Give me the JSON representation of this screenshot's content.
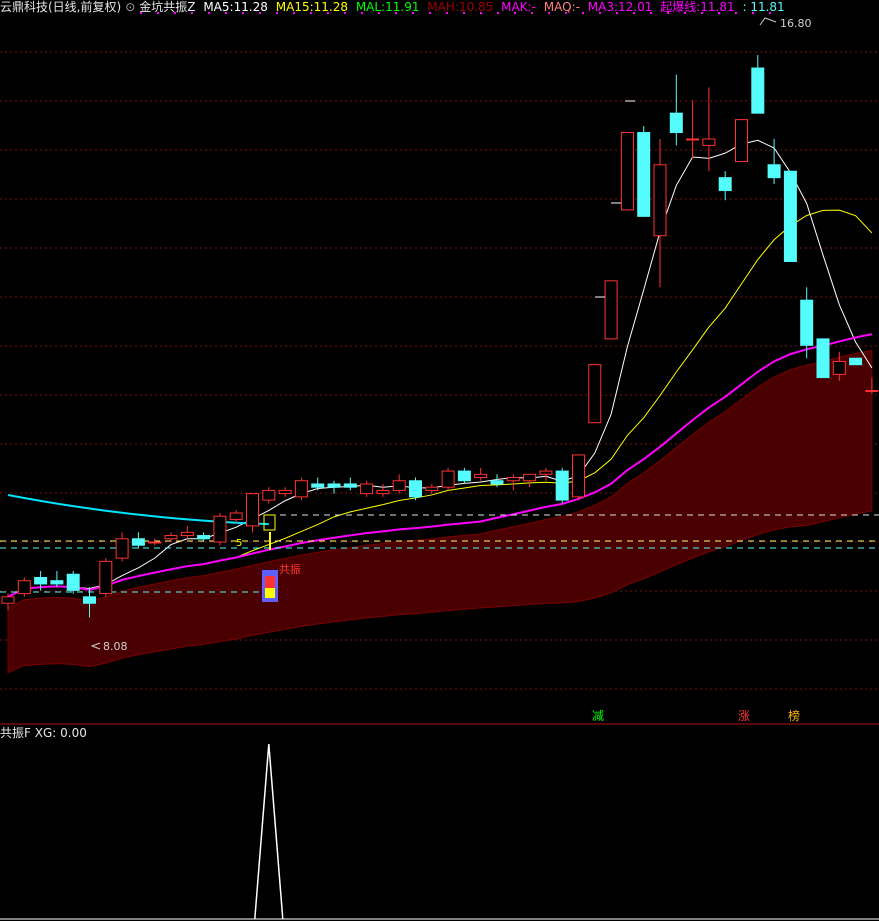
{
  "header": {
    "stock_name": "云鼎科技(日线,前复权)",
    "indicator_name": "金坑共振Z",
    "ma5_label": "MA5:",
    "ma5_value": "11.28",
    "ma15_label": "MA15:",
    "ma15_value": "11.28",
    "mal_label": "MAL:",
    "mal_value": "11.91",
    "mah_label": "MAH:",
    "mah_value": "10.85",
    "mak_label": "MAK:",
    "mak_value": "-",
    "maq_label": "MAQ:",
    "maq_value": "-",
    "ma3_label": "MA3:",
    "ma3_value": "12.01",
    "qbx_label": "起爆线:",
    "qbx_value": "11.81",
    "extra_value": ": 11.81"
  },
  "sub_header": {
    "name": "共振F",
    "xg_label": "XG:",
    "xg_value": "0.00"
  },
  "markers": {
    "signal_text": "共振",
    "small_label": "5",
    "jian": "减",
    "zhang": "涨",
    "bang": "榜"
  },
  "colors": {
    "up": "#ff3232",
    "down": "#54fcfc",
    "ma5": "#ffffff",
    "ma15": "#ffff00",
    "mal": "#ff00ff",
    "mah": "#a00000",
    "cyan_line": "#00e5ff"
  },
  "chart_data": {
    "type": "candlestick",
    "price_axis_annotations": {
      "high_label": "16.80",
      "low_label": "8.08"
    },
    "ohlc_approx": [
      [
        8.3,
        8.45,
        8.2,
        8.4
      ],
      [
        8.45,
        8.7,
        8.4,
        8.65
      ],
      [
        8.7,
        8.8,
        8.5,
        8.6
      ],
      [
        8.65,
        8.8,
        8.55,
        8.6
      ],
      [
        8.75,
        8.8,
        8.45,
        8.5
      ],
      [
        8.4,
        8.55,
        8.08,
        8.3
      ],
      [
        8.45,
        9.0,
        8.4,
        8.95
      ],
      [
        9.0,
        9.4,
        8.95,
        9.3
      ],
      [
        9.3,
        9.4,
        9.15,
        9.2
      ],
      [
        9.25,
        9.3,
        9.2,
        9.25
      ],
      [
        9.3,
        9.4,
        9.25,
        9.35
      ],
      [
        9.35,
        9.5,
        9.3,
        9.4
      ],
      [
        9.35,
        9.4,
        9.25,
        9.3
      ],
      [
        9.25,
        9.7,
        9.2,
        9.65
      ],
      [
        9.6,
        9.75,
        9.55,
        9.7
      ],
      [
        9.5,
        9.9,
        9.4,
        10.0
      ],
      [
        9.9,
        10.1,
        9.85,
        10.05
      ],
      [
        10.0,
        10.1,
        9.95,
        10.05
      ],
      [
        9.95,
        10.25,
        9.9,
        10.2
      ],
      [
        10.15,
        10.25,
        10.05,
        10.1
      ],
      [
        10.15,
        10.2,
        10.0,
        10.1
      ],
      [
        10.15,
        10.25,
        10.05,
        10.1
      ],
      [
        10.0,
        10.2,
        9.95,
        10.15
      ],
      [
        10.0,
        10.15,
        9.95,
        10.05
      ],
      [
        10.05,
        10.3,
        10.0,
        10.2
      ],
      [
        10.2,
        10.25,
        9.9,
        9.95
      ],
      [
        10.05,
        10.15,
        10.0,
        10.1
      ],
      [
        10.1,
        10.4,
        10.05,
        10.35
      ],
      [
        10.35,
        10.4,
        10.15,
        10.2
      ],
      [
        10.25,
        10.4,
        10.2,
        10.3
      ],
      [
        10.2,
        10.3,
        10.1,
        10.15
      ],
      [
        10.2,
        10.3,
        10.05,
        10.25
      ],
      [
        10.2,
        10.3,
        10.1,
        10.3
      ],
      [
        10.3,
        10.4,
        10.2,
        10.35
      ],
      [
        10.35,
        10.4,
        9.85,
        9.9
      ],
      [
        9.95,
        10.6,
        9.9,
        10.6
      ],
      [
        11.1,
        12.0,
        11.1,
        12.0
      ],
      [
        12.4,
        13.3,
        12.4,
        13.3
      ],
      [
        14.4,
        15.6,
        14.4,
        15.6
      ],
      [
        15.6,
        15.7,
        14.3,
        14.3
      ],
      [
        14.0,
        15.5,
        13.2,
        15.1
      ],
      [
        15.9,
        16.5,
        15.4,
        15.6
      ],
      [
        15.5,
        16.1,
        15.2,
        15.5
      ],
      [
        15.4,
        16.3,
        15.0,
        15.5
      ],
      [
        14.9,
        15.0,
        14.55,
        14.7
      ],
      [
        15.15,
        15.8,
        15.15,
        15.8
      ],
      [
        16.6,
        16.8,
        15.9,
        15.9
      ],
      [
        15.1,
        15.5,
        14.8,
        14.9
      ],
      [
        15.0,
        15.0,
        13.6,
        13.6
      ],
      [
        13.0,
        13.2,
        12.1,
        12.3
      ],
      [
        12.4,
        12.4,
        11.8,
        11.8
      ],
      [
        11.85,
        12.2,
        11.75,
        12.05
      ],
      [
        12.1,
        12.1,
        12.0,
        12.0
      ],
      [
        11.6,
        11.8,
        11.55,
        11.6
      ]
    ],
    "series": [
      {
        "name": "MA5",
        "values": []
      },
      {
        "name": "MA15",
        "values": []
      },
      {
        "name": "MAL",
        "values": []
      },
      {
        "name": "MAH",
        "values": []
      }
    ],
    "sub_series": [
      {
        "name": "XG",
        "values": [
          0,
          0,
          0,
          0,
          0,
          0,
          0,
          0,
          0,
          0,
          0,
          0,
          0,
          0,
          0,
          0,
          1,
          0,
          0,
          0,
          0,
          0,
          0,
          0,
          0,
          0,
          0,
          0,
          0,
          0,
          0,
          0,
          0,
          0,
          0,
          0,
          0,
          0,
          0,
          0,
          0,
          0,
          0,
          0,
          0,
          0,
          0,
          0,
          0,
          0,
          0,
          0,
          0,
          0
        ]
      }
    ]
  }
}
